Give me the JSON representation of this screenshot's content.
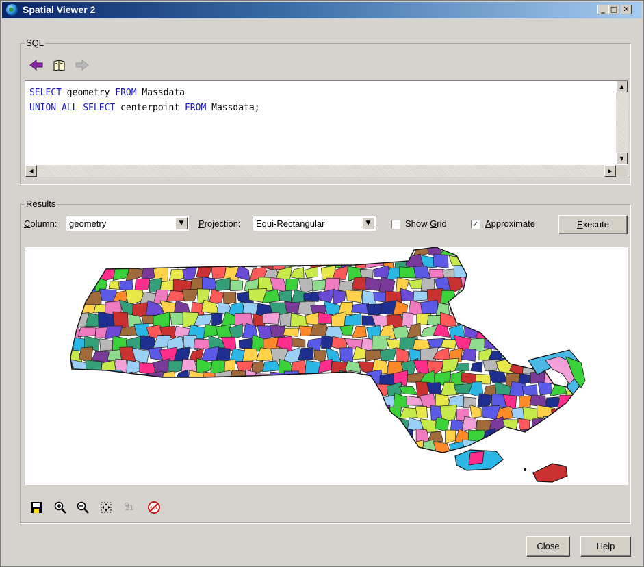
{
  "window": {
    "title": "Spatial Viewer 2",
    "controls": [
      "_",
      "□",
      "✕"
    ]
  },
  "sql_group": {
    "label": "SQL",
    "nav_icons": [
      "back-arrow-icon",
      "history-book-icon",
      "forward-arrow-icon"
    ],
    "query_lines": [
      [
        {
          "text": "SELECT",
          "kw": true
        },
        {
          "text": " geometry ",
          "kw": false
        },
        {
          "text": "FROM",
          "kw": true
        },
        {
          "text": " Massdata",
          "kw": false
        }
      ],
      [
        {
          "text": "UNION ALL SELECT",
          "kw": true
        },
        {
          "text": " centerpoint ",
          "kw": false
        },
        {
          "text": "FROM",
          "kw": true
        },
        {
          "text": " Massdata;",
          "kw": false
        }
      ]
    ]
  },
  "results_group": {
    "label": "Results",
    "column_label": "Column:",
    "column_mnemonic": "C",
    "column_value": "geometry",
    "projection_label": "Projection:",
    "projection_mnemonic": "P",
    "projection_value": "Equi-Rectangular",
    "show_grid_label": "Show Grid",
    "show_grid_checked": false,
    "approximate_label": "Approximate",
    "approximate_checked": true,
    "execute_label": "Execute",
    "map_colors": [
      "#e8e84a",
      "#ff2d8c",
      "#3ad13a",
      "#6b4bd6",
      "#ff8a2a",
      "#2ab7e6",
      "#c93030",
      "#8fdc8f",
      "#f2a0d8",
      "#1f2f8f",
      "#b8b8b8",
      "#ffd24a",
      "#7a3a9a",
      "#34a07a",
      "#ff5a5a",
      "#9ad0f5",
      "#c6ea4a",
      "#a06a3a",
      "#5a5ae6",
      "#f07ac0"
    ],
    "toolbar_icons": [
      "save-icon",
      "zoom-in-icon",
      "zoom-out-icon",
      "zoom-to-fit-icon",
      "coordinates-icon",
      "clear-sql-icon"
    ]
  },
  "footer": {
    "close_label": "Close",
    "help_label": "Help"
  }
}
